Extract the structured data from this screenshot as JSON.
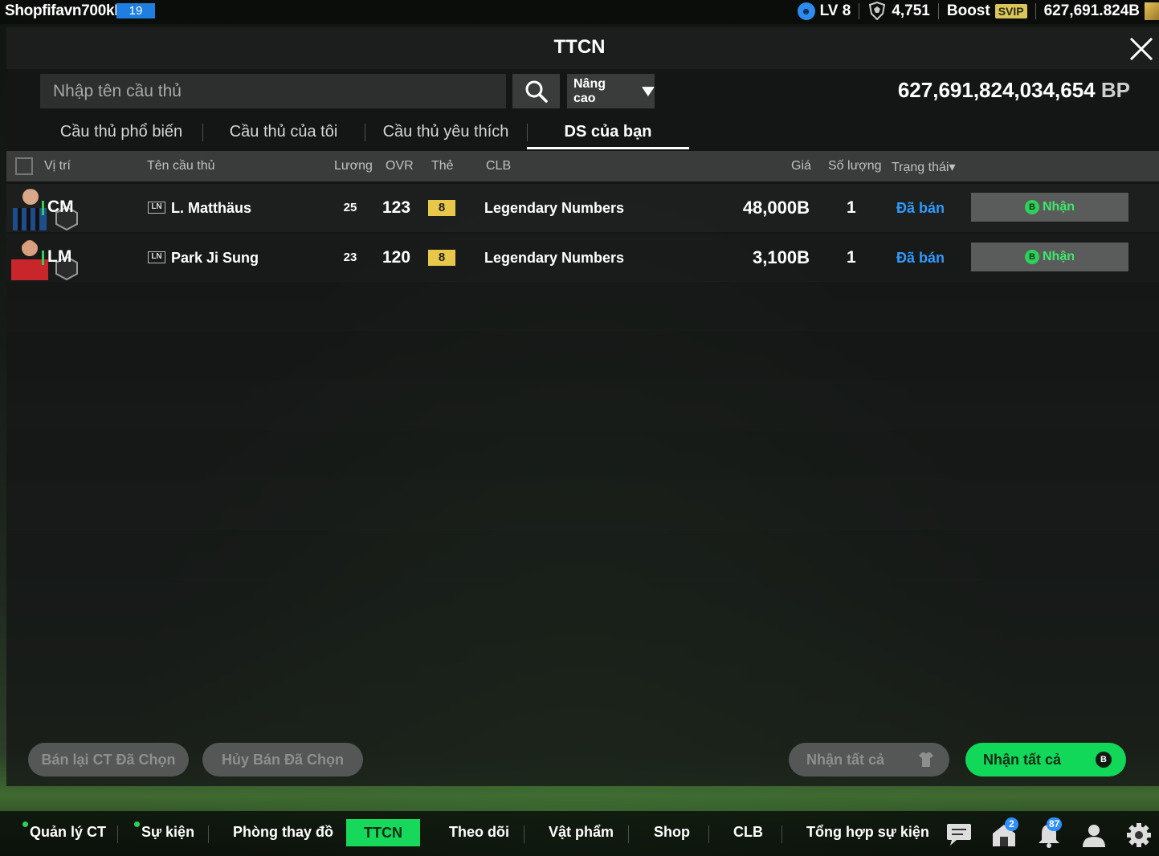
{
  "topbar": {
    "username": "Shopfifavn700kB",
    "user_badge": "19",
    "level": "LV 8",
    "trophies": "4,751",
    "boost": "Boost",
    "svip": "SVIP",
    "bp_short": "627,691.824B"
  },
  "panel": {
    "title": "TTCN",
    "search_placeholder": "Nhập tên cầu thủ",
    "advanced_label": "Nâng cao",
    "bp_total": "627,691,824,034,654",
    "bp_unit": "BP"
  },
  "tabs": [
    {
      "label": "Cầu thủ phổ biến"
    },
    {
      "label": "Cầu thủ của tôi"
    },
    {
      "label": "Cầu thủ yêu thích"
    },
    {
      "label": "DS của bạn"
    }
  ],
  "table": {
    "headers": {
      "position": "Vị trí",
      "name": "Tên cầu thủ",
      "salary": "Lương",
      "ovr": "OVR",
      "card": "Thẻ",
      "club": "CLB",
      "price": "Giá",
      "quantity": "Số lượng",
      "status": "Trạng thái"
    },
    "rows": [
      {
        "position": "CM",
        "season": "LN",
        "name": "L. Matthäus",
        "salary": "25",
        "ovr": "123",
        "card": "8",
        "club": "Legendary Numbers",
        "price": "48,000B",
        "quantity": "1",
        "status": "Đã bán",
        "action": "Nhận"
      },
      {
        "position": "LM",
        "season": "LN",
        "name": "Park Ji Sung",
        "salary": "23",
        "ovr": "120",
        "card": "8",
        "club": "Legendary Numbers",
        "price": "3,100B",
        "quantity": "1",
        "status": "Đã bán",
        "action": "Nhận"
      }
    ]
  },
  "actions": {
    "resell_selected": "Bán lại CT Đã Chọn",
    "cancel_selected": "Hủy Bán Đã Chọn",
    "claim_all_grey": "Nhận tất cả",
    "claim_all_green": "Nhận tất cả"
  },
  "coin_letter": "B",
  "bottomnav": {
    "items": [
      "Quản lý CT",
      "Sự kiện",
      "Phòng thay đồ",
      "TTCN",
      "Theo dõi",
      "Vật phẩm",
      "Shop",
      "CLB",
      "Tổng hợp sự kiện"
    ],
    "mail_count": "2",
    "notif_count": "87"
  },
  "colors": {
    "accent_green": "#12d85a",
    "status_blue": "#2e9bff",
    "card_yellow": "#e8c84a",
    "level_blue": "#1e7fe0"
  }
}
